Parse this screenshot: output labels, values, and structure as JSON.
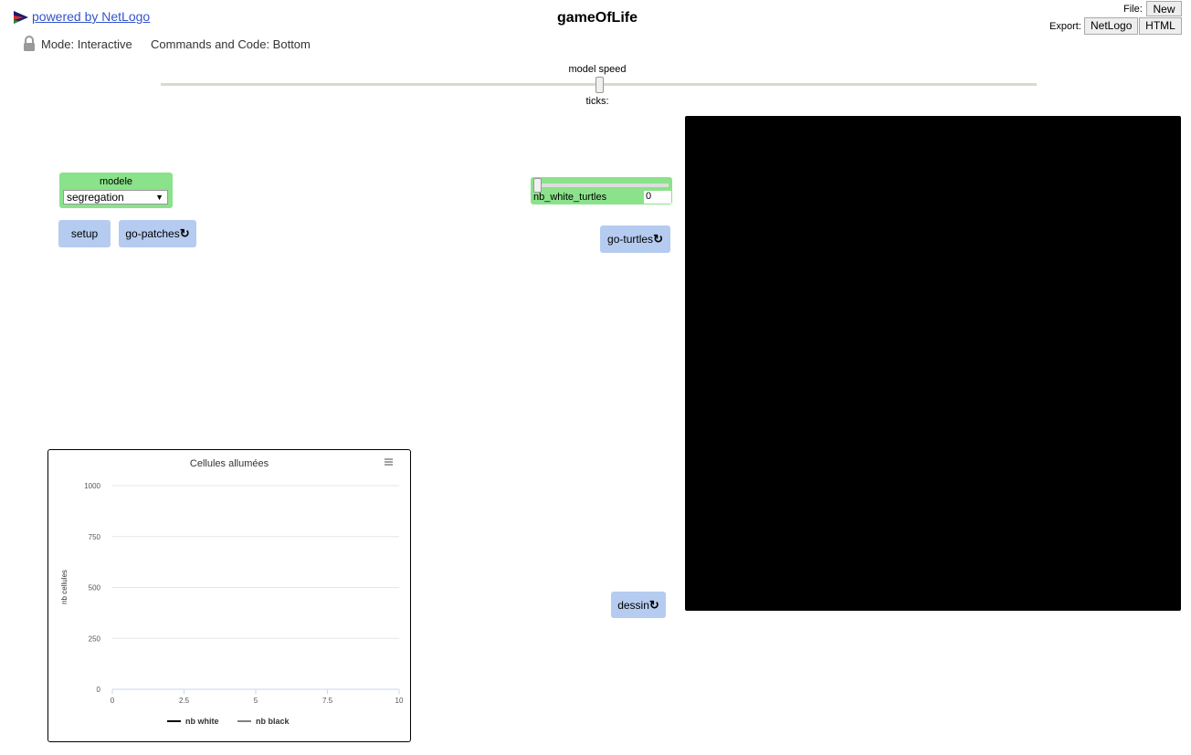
{
  "header": {
    "powered_text": "powered by NetLogo",
    "title": "gameOfLife",
    "mode_label": "Mode: Interactive",
    "commands_label": "Commands and Code: Bottom",
    "file_label": "File:",
    "new_label": "New",
    "export_label": "Export:",
    "export_netlogo": "NetLogo",
    "export_html": "HTML"
  },
  "speed": {
    "label": "model speed",
    "ticks_label": "ticks:",
    "value": 0.5
  },
  "chooser": {
    "label": "modele",
    "value": "segregation"
  },
  "buttons": {
    "setup": "setup",
    "go_patches": "go-patches",
    "go_turtles": "go-turtles",
    "dessin": "dessin"
  },
  "slider": {
    "name": "nb_white_turtles",
    "value": "0"
  },
  "plot": {
    "title": "Cellules allumées",
    "ylabel": "nb cellules",
    "yticks": [
      "0",
      "250",
      "500",
      "750",
      "1000"
    ],
    "xticks": [
      "0",
      "2.5",
      "5",
      "7.5",
      "10"
    ],
    "legend": [
      {
        "name": "nb white",
        "color": "#000000"
      },
      {
        "name": "nb black",
        "color": "#808080"
      }
    ]
  },
  "chart_data": {
    "type": "line",
    "title": "Cellules allumées",
    "xlabel": "",
    "ylabel": "nb cellules",
    "xlim": [
      0,
      10
    ],
    "ylim": [
      0,
      1000
    ],
    "grid": true,
    "legend_position": "bottom",
    "series": [
      {
        "name": "nb white",
        "color": "#000000",
        "values": []
      },
      {
        "name": "nb black",
        "color": "#808080",
        "values": []
      }
    ]
  }
}
